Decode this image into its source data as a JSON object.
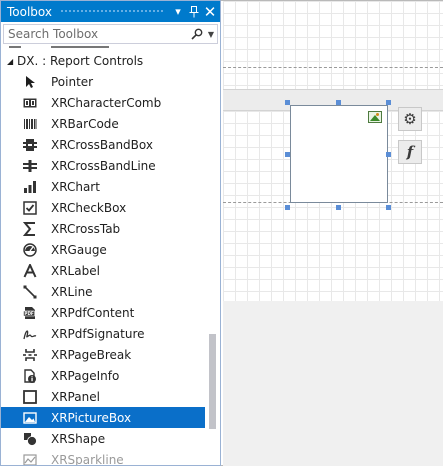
{
  "toolbox": {
    "title": "Toolbox",
    "pin_glyph": "▾",
    "close_glyph": "✕",
    "search": {
      "placeholder": "Search Toolbox",
      "value": ""
    },
    "group": {
      "expand_glyph": "◢",
      "label": "DX.       : Report Controls"
    },
    "items": [
      {
        "label": "Pointer",
        "icon": "pointer-icon"
      },
      {
        "label": "XRCharacterComb",
        "icon": "character-comb-icon"
      },
      {
        "label": "XRBarCode",
        "icon": "barcode-icon"
      },
      {
        "label": "XRCrossBandBox",
        "icon": "cross-band-box-icon"
      },
      {
        "label": "XRCrossBandLine",
        "icon": "cross-band-line-icon"
      },
      {
        "label": "XRChart",
        "icon": "chart-icon"
      },
      {
        "label": "XRCheckBox",
        "icon": "checkbox-icon"
      },
      {
        "label": "XRCrossTab",
        "icon": "sigma-icon"
      },
      {
        "label": "XRGauge",
        "icon": "gauge-icon"
      },
      {
        "label": "XRLabel",
        "icon": "label-icon"
      },
      {
        "label": "XRLine",
        "icon": "line-icon"
      },
      {
        "label": "XRPdfContent",
        "icon": "pdf-icon"
      },
      {
        "label": "XRPdfSignature",
        "icon": "signature-icon"
      },
      {
        "label": "XRPageBreak",
        "icon": "page-break-icon"
      },
      {
        "label": "XRPageInfo",
        "icon": "page-info-icon"
      },
      {
        "label": "XRPanel",
        "icon": "panel-icon"
      },
      {
        "label": "XRPictureBox",
        "icon": "picture-icon",
        "selected": true
      },
      {
        "label": "XRShape",
        "icon": "shape-icon"
      },
      {
        "label": "XRSparkline",
        "icon": "sparkline-icon"
      }
    ]
  },
  "designer": {
    "smart_tags": [
      {
        "icon": "gear-icon",
        "glyph": "⚙"
      },
      {
        "icon": "function-icon",
        "glyph": "f"
      }
    ]
  },
  "colors": {
    "title_bar": "#007acc",
    "selected_item": "#0a6fc9",
    "selection_handle": "#5b8ed6"
  }
}
